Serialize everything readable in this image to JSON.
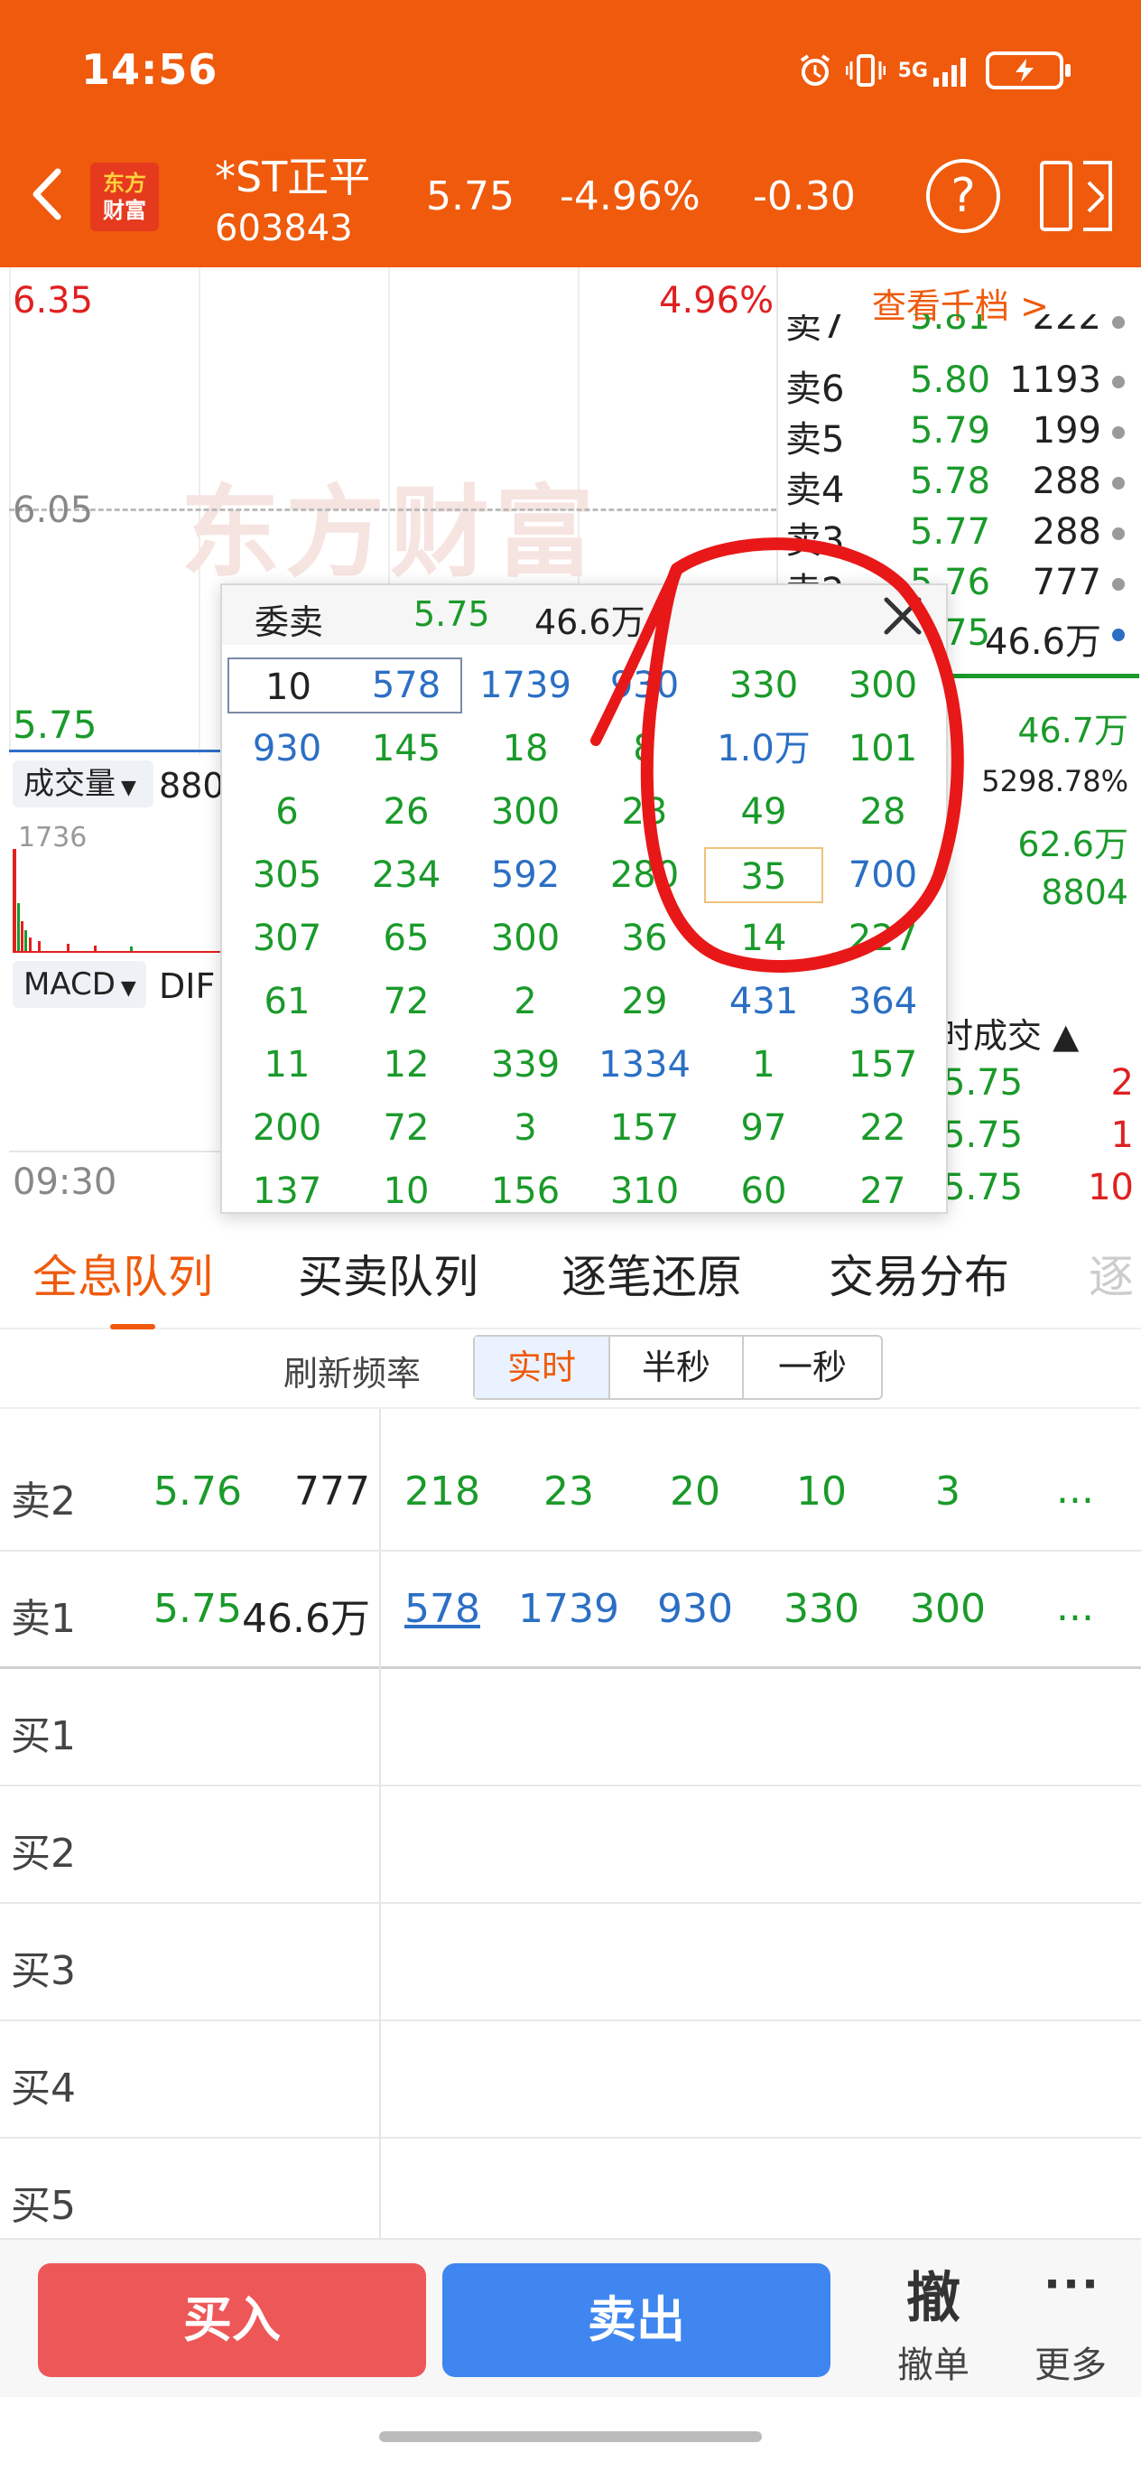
{
  "status": {
    "time": "14:56",
    "network": "5G"
  },
  "header": {
    "logo_line1": "东方",
    "logo_line2": "财富",
    "stock_name": "*ST正平",
    "stock_code": "603843",
    "price": "5.75",
    "pct": "-4.96%",
    "change": "-0.30"
  },
  "chart": {
    "price_high": "6.35",
    "pct_high": "4.96%",
    "price_mid": "6.05",
    "price_low": "5.75",
    "watermark": "东方财富",
    "volume_label": "成交量",
    "volume_value": "880",
    "volume_max": "1736",
    "macd_label": "MACD",
    "macd_dif": "DIF",
    "time_start": "09:30"
  },
  "orderbook": {
    "view_more": "查看千档 >",
    "rows": [
      {
        "label": "卖7",
        "price": "5.81",
        "vol": "222"
      },
      {
        "label": "卖6",
        "price": "5.80",
        "vol": "1193"
      },
      {
        "label": "卖5",
        "price": "5.79",
        "vol": "199"
      },
      {
        "label": "卖4",
        "price": "5.78",
        "vol": "288"
      },
      {
        "label": "卖3",
        "price": "5.77",
        "vol": "288"
      },
      {
        "label": "卖2",
        "price": "5.76",
        "vol": "777"
      },
      {
        "label": "卖1",
        "price": "5.75",
        "vol": "46.6万"
      }
    ],
    "stats": {
      "vol": "46.7万",
      "turnover_pct": "5298.78%",
      "inner": "62.6万",
      "outer": "8804"
    },
    "trades_label": "时成交 ▲",
    "trades": [
      {
        "price": "5.75",
        "vol": "2"
      },
      {
        "price": "5.75",
        "vol": "1"
      },
      {
        "price": "5.75",
        "vol": "10"
      }
    ]
  },
  "popup": {
    "title": "委卖",
    "price": "5.75",
    "volume": "46.6万",
    "rows": [
      [
        "10",
        "578",
        "1739",
        "930",
        "330",
        "300"
      ],
      [
        "930",
        "145",
        "18",
        "8",
        "1.0万",
        "101"
      ],
      [
        "6",
        "26",
        "300",
        "23",
        "49",
        "28"
      ],
      [
        "305",
        "234",
        "592",
        "280",
        "35",
        "700"
      ],
      [
        "307",
        "65",
        "300",
        "36",
        "14",
        "227"
      ],
      [
        "61",
        "72",
        "2",
        "29",
        "431",
        "364"
      ],
      [
        "11",
        "12",
        "339",
        "1334",
        "1",
        "157"
      ],
      [
        "200",
        "72",
        "3",
        "157",
        "97",
        "22"
      ],
      [
        "137",
        "10",
        "156",
        "310",
        "60",
        "27"
      ]
    ]
  },
  "tabs": [
    "全息队列",
    "买卖队列",
    "逐笔还原",
    "交易分布",
    "逐"
  ],
  "refresh": {
    "label": "刷新频率",
    "options": [
      "实时",
      "半秒",
      "一秒"
    ],
    "selected": "实时"
  },
  "queue": {
    "rows": [
      {
        "label": "卖2",
        "price": "5.76",
        "vol": "777",
        "cells": [
          "218",
          "23",
          "20",
          "10",
          "3"
        ],
        "more": "..."
      },
      {
        "label": "卖1",
        "price": "5.75",
        "vol": "46.6万",
        "cells": [
          "578",
          "1739",
          "930",
          "330",
          "300"
        ],
        "more": "..."
      },
      {
        "label": "买1"
      },
      {
        "label": "买2"
      },
      {
        "label": "买3"
      },
      {
        "label": "买4"
      },
      {
        "label": "买5"
      }
    ]
  },
  "bottom": {
    "buy": "买入",
    "sell": "卖出",
    "cancel_glyph": "撤",
    "cancel": "撤单",
    "more_glyph": "···",
    "more": "更多"
  },
  "colors": {
    "brand": "#ef5a0c",
    "up": "#e02020",
    "down": "#1a9a2a",
    "link": "#2b6fc4",
    "buy": "#ee5757",
    "sell": "#3f86f0"
  }
}
